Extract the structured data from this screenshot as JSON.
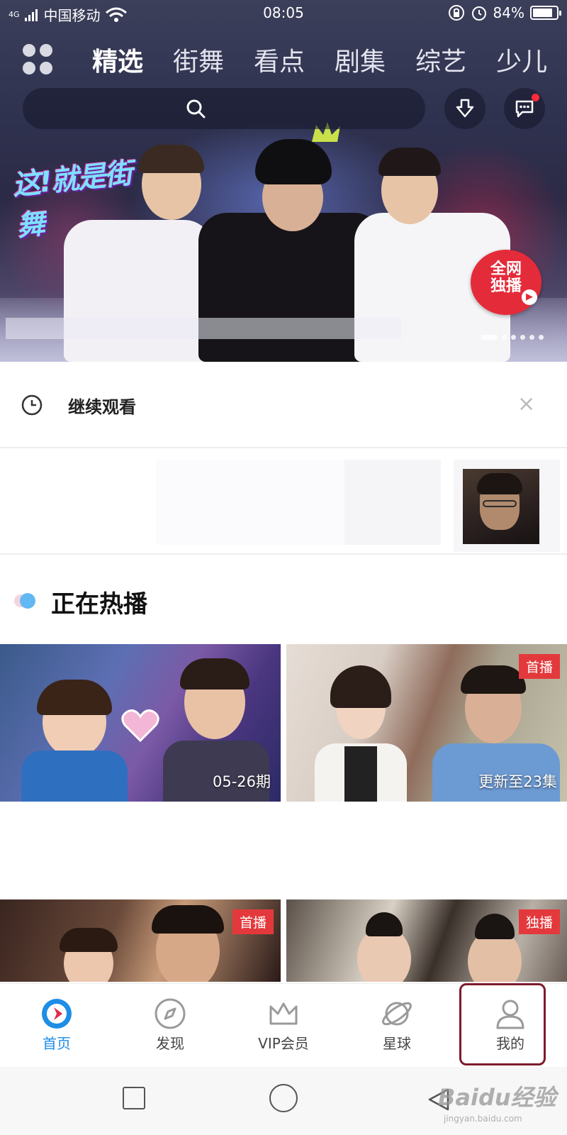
{
  "status_bar": {
    "network": "4G",
    "carrier": "中国移动",
    "time": "08:05",
    "battery_text": "84%",
    "battery_level": 0.84
  },
  "tabs": [
    {
      "label": "精选",
      "active": true
    },
    {
      "label": "街舞",
      "active": false
    },
    {
      "label": "看点",
      "active": false
    },
    {
      "label": "剧集",
      "active": false
    },
    {
      "label": "综艺",
      "active": false
    },
    {
      "label": "少儿",
      "active": false
    }
  ],
  "banner": {
    "show_logo_text": "这!就是街舞",
    "badge_line1": "全网",
    "badge_line2": "独播",
    "page_count": 6,
    "active_page": 1
  },
  "continue_watching": {
    "title": "继续观看",
    "close": "×"
  },
  "hot_section": {
    "title": "正在热播",
    "cards": [
      {
        "overlay": "05-26期",
        "badge": ""
      },
      {
        "overlay": "更新至23集",
        "badge": "首播"
      },
      {
        "overlay": "",
        "badge": "首播"
      },
      {
        "overlay": "",
        "badge": "独播"
      }
    ]
  },
  "bottom_nav": [
    {
      "label": "首页",
      "icon": "youku-home-icon",
      "active": true
    },
    {
      "label": "发现",
      "icon": "compass-icon",
      "active": false
    },
    {
      "label": "VIP会员",
      "icon": "crown-icon",
      "active": false
    },
    {
      "label": "星球",
      "icon": "planet-icon",
      "active": false
    },
    {
      "label": "我的",
      "icon": "user-icon",
      "active": false
    }
  ],
  "watermark": {
    "text": "Baidu经验",
    "sub": "jingyan.baidu.com"
  },
  "colors": {
    "accent": "#1e8de6",
    "badge_red": "#e4393c",
    "highlight_box": "#7d1b2c"
  }
}
